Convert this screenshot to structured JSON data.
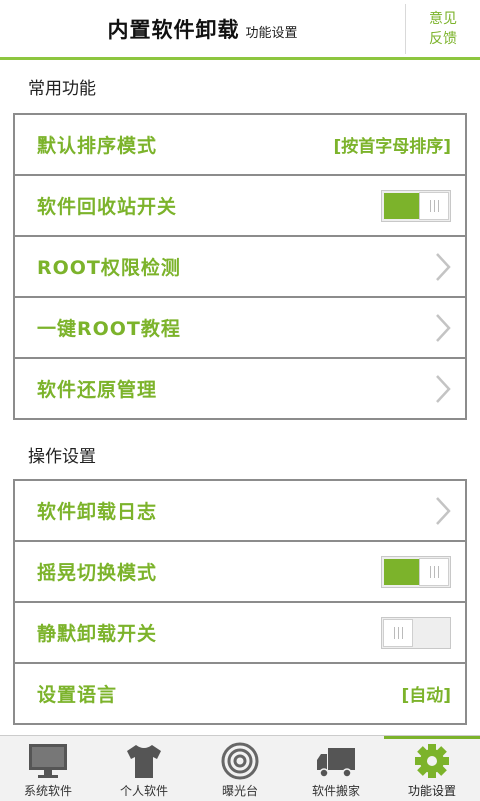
{
  "header": {
    "title": "内置软件卸载",
    "subtitle": "功能设置",
    "feedback_line1": "意见",
    "feedback_line2": "反馈"
  },
  "sections": {
    "common": {
      "title": "常用功能",
      "sort_label": "默认排序模式",
      "sort_value": "[按首字母排序]",
      "recycle_label": "软件回收站开关",
      "recycle_on": true,
      "root_check_label": "ROOT权限检测",
      "root_tutorial_label": "一键ROOT教程",
      "restore_label": "软件还原管理"
    },
    "ops": {
      "title": "操作设置",
      "log_label": "软件卸载日志",
      "shake_label": "摇晃切换模式",
      "shake_on": true,
      "silent_label": "静默卸载开关",
      "silent_on": false,
      "language_label": "设置语言",
      "language_value": "[自动]"
    }
  },
  "tabs": [
    {
      "label": "系统软件",
      "icon": "monitor-icon"
    },
    {
      "label": "个人软件",
      "icon": "tshirt-icon"
    },
    {
      "label": "曝光台",
      "icon": "target-icon"
    },
    {
      "label": "软件搬家",
      "icon": "truck-icon"
    },
    {
      "label": "功能设置",
      "icon": "gear-icon",
      "active": true
    }
  ],
  "colors": {
    "accent": "#7cb32b",
    "border": "#8c8c8c"
  }
}
